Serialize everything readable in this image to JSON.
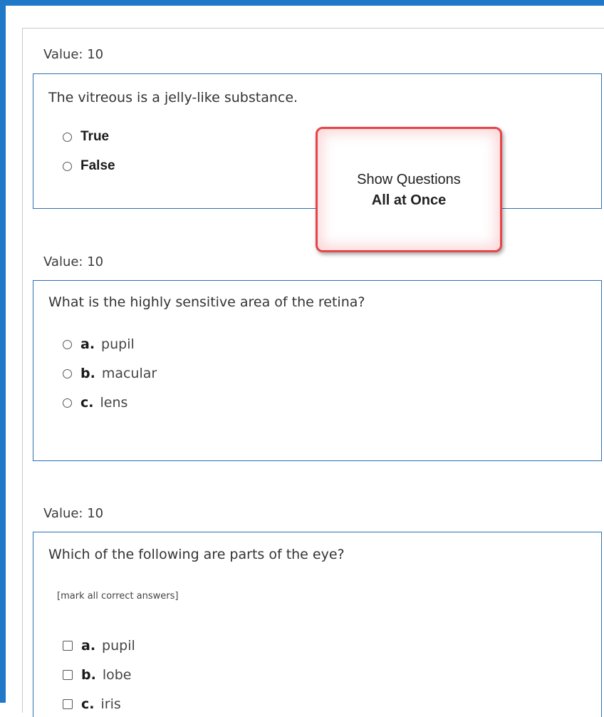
{
  "questions": [
    {
      "value_label": "Value: 10",
      "text": "The vitreous is a jelly-like substance.",
      "options": [
        {
          "label": "True"
        },
        {
          "label": "False"
        }
      ]
    },
    {
      "value_label": "Value: 10",
      "text": "What is the highly sensitive area of the retina?",
      "options": [
        {
          "letter": "a.",
          "label": "pupil"
        },
        {
          "letter": "b.",
          "label": "macular"
        },
        {
          "letter": "c.",
          "label": "lens"
        }
      ]
    },
    {
      "value_label": "Value: 10",
      "text": "Which of the following are parts of the eye?",
      "note": "[mark all correct answers]",
      "options": [
        {
          "letter": "a.",
          "label": "pupil"
        },
        {
          "letter": "b.",
          "label": "lobe"
        },
        {
          "letter": "c.",
          "label": "iris"
        }
      ]
    }
  ],
  "callout": {
    "line1": "Show Questions",
    "line2": "All at Once"
  },
  "colors": {
    "frame": "#1f78c8",
    "question_border": "#2a6fb4",
    "callout_border": "#e8454a"
  }
}
